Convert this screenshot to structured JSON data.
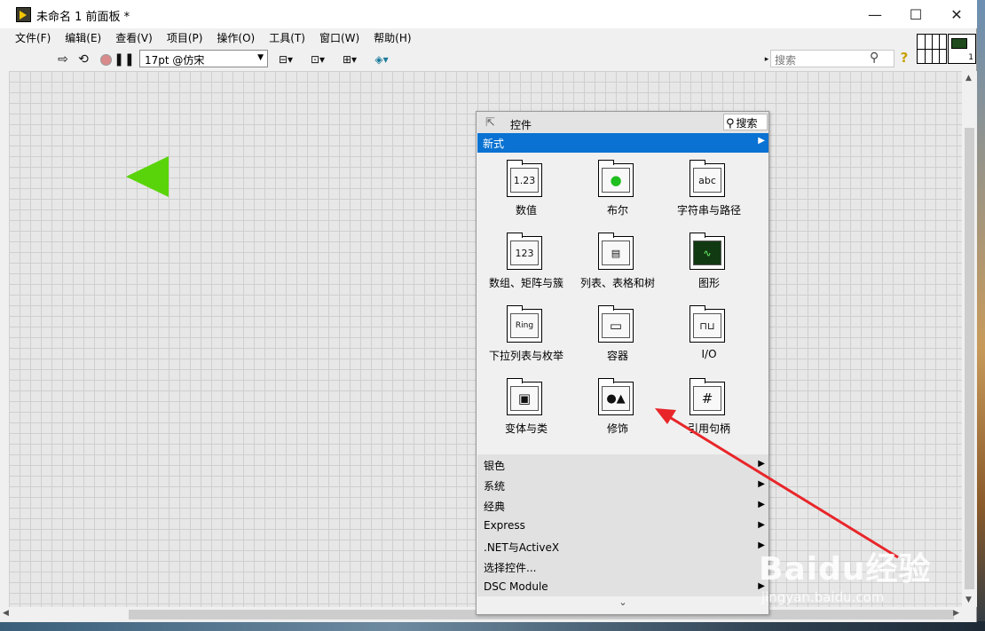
{
  "window": {
    "title": "未命名 1 前面板 *"
  },
  "window_controls": {
    "minimize": "—",
    "maximize": "☐",
    "close": "✕"
  },
  "menubar": [
    "文件(F)",
    "编辑(E)",
    "查看(V)",
    "项目(P)",
    "操作(O)",
    "工具(T)",
    "窗口(W)",
    "帮助(H)"
  ],
  "toolbar": {
    "font": "17pt @仿宋",
    "search_placeholder": "搜索",
    "help": "?",
    "vi_number": "1"
  },
  "palette": {
    "title": "控件",
    "search_label": "搜索",
    "current_category": "新式",
    "items": [
      {
        "label": "数值",
        "glyph": "1.23"
      },
      {
        "label": "布尔",
        "glyph": "●"
      },
      {
        "label": "字符串与路径",
        "glyph": "abc"
      },
      {
        "label": "数组、矩阵与簇",
        "glyph": "123"
      },
      {
        "label": "列表、表格和树",
        "glyph": "▤"
      },
      {
        "label": "图形",
        "glyph": "∿"
      },
      {
        "label": "下拉列表与枚举",
        "glyph": "Ring"
      },
      {
        "label": "容器",
        "glyph": "▭"
      },
      {
        "label": "I/O",
        "glyph": "⊓⊔"
      },
      {
        "label": "变体与类",
        "glyph": "▣"
      },
      {
        "label": "修饰",
        "glyph": "●▲"
      },
      {
        "label": "引用句柄",
        "glyph": "#"
      }
    ],
    "subcategories": [
      "银色",
      "系统",
      "经典",
      "Express",
      ".NET与ActiveX",
      "选择控件...",
      "DSC Module"
    ],
    "more": "⌄"
  },
  "watermark": {
    "brand": "Baidu经验",
    "url": "jingyan.baidu.com"
  },
  "colors": {
    "run_arrow": "#5ad40a",
    "selection": "#0a72d2",
    "annotation_arrow": "#e8262a"
  },
  "icons": [
    "labview-vi-icon",
    "run-icon",
    "run-continuously-icon",
    "abort-icon",
    "pause-icon",
    "align-icon",
    "distribute-icon",
    "resize-icon",
    "reorder-icon",
    "search-icon",
    "help-icon",
    "pin-icon"
  ]
}
